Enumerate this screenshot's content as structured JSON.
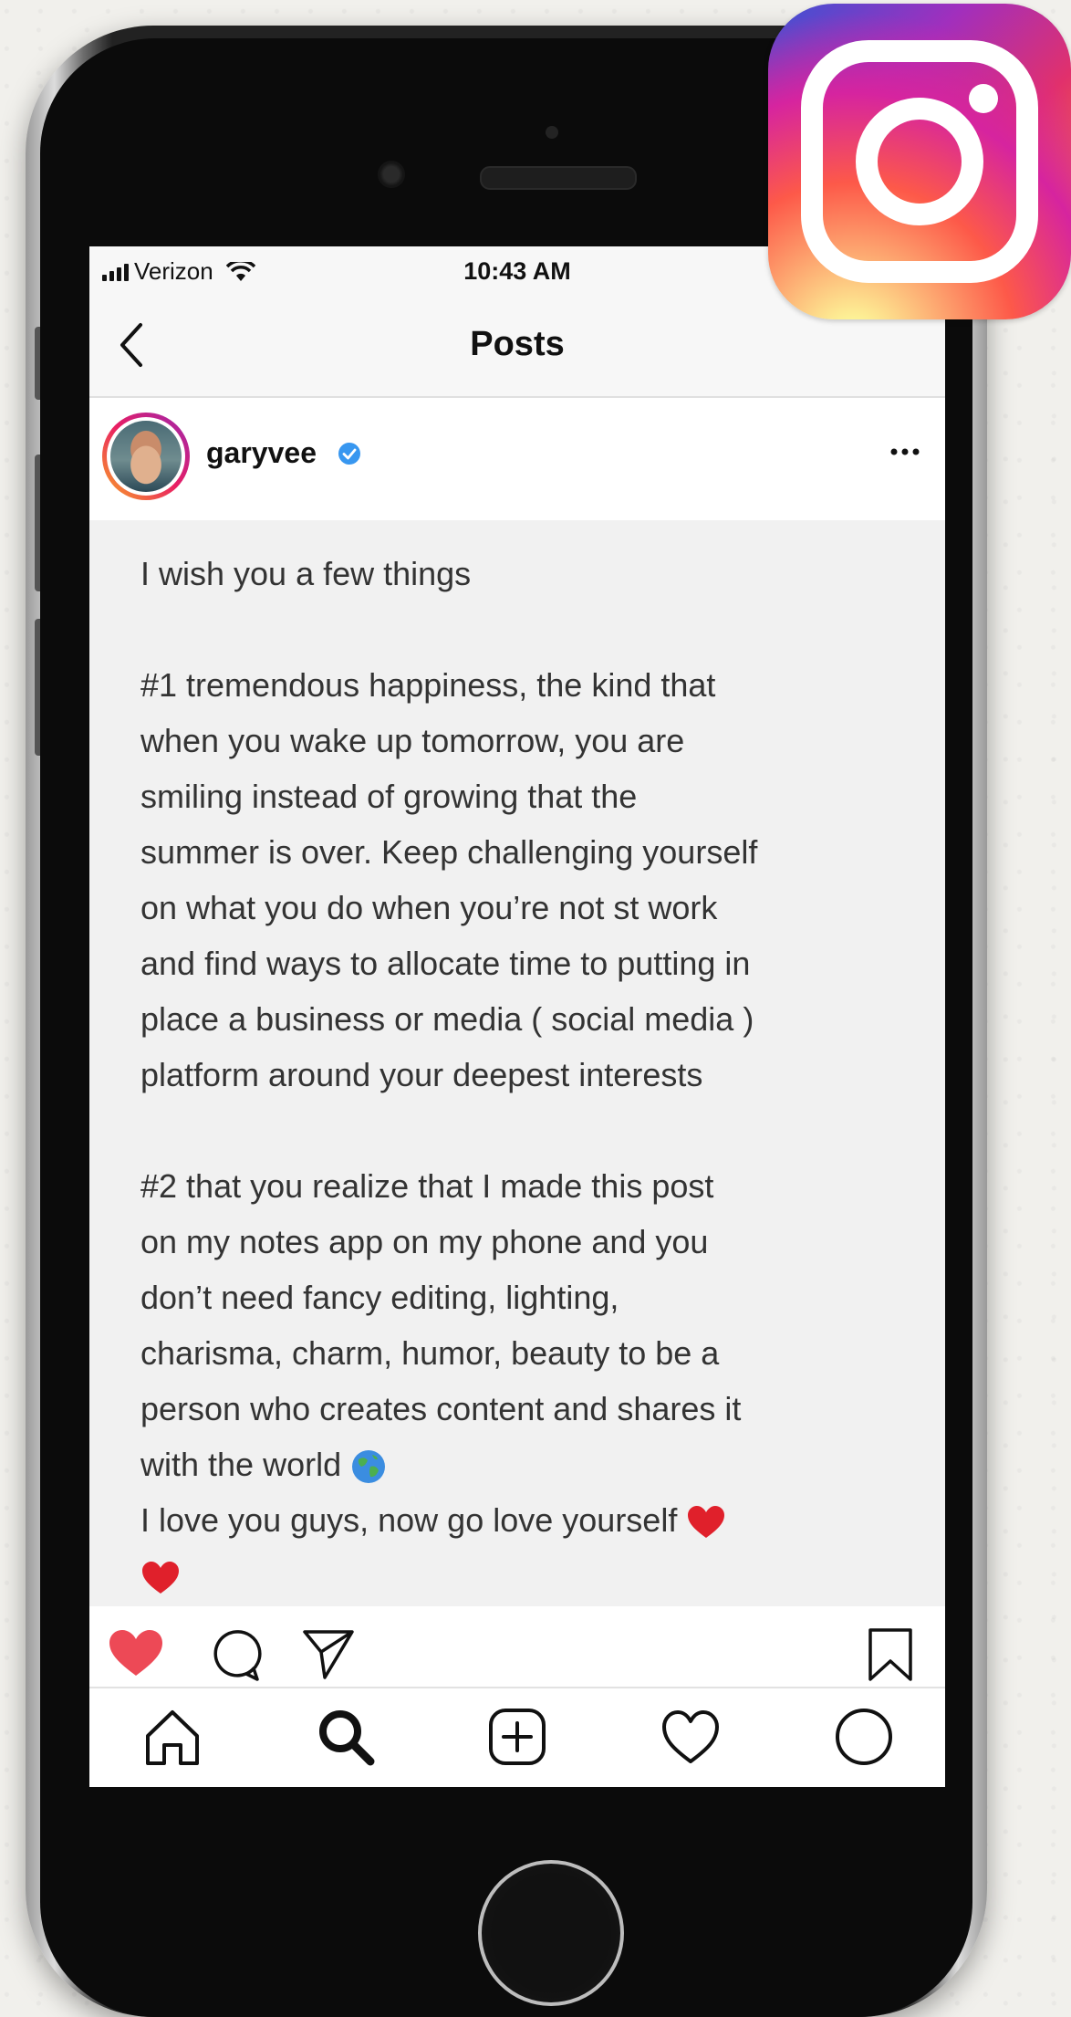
{
  "status_bar": {
    "carrier": "Verizon",
    "time": "10:43 AM"
  },
  "nav": {
    "title": "Posts"
  },
  "post": {
    "username": "garyvee",
    "verified": true,
    "caption_lines": [
      "I wish you a few things",
      "",
      "#1 tremendous happiness, the kind that",
      "when you wake up tomorrow, you are",
      "smiling instead of growing that the",
      "summer is over. Keep challenging yourself",
      "on what you do when you’re not st work",
      "and find ways to allocate time to putting in",
      "place a business or media ( social media )",
      "platform around your deepest interests",
      "",
      "#2 that you realize that I made this post",
      "on my notes app on my phone and you",
      "don’t need fancy editing, lighting,",
      "charisma, charm, humor, beauty to be a",
      "person who creates content and shares it",
      "with the world",
      "I love you guys, now go love yourself"
    ],
    "liked": true
  },
  "icons": {
    "back": "chevron-left-icon",
    "more": "more-horizontal-icon",
    "like": "heart-filled-icon",
    "comment": "comment-icon",
    "share": "send-icon",
    "save": "bookmark-icon",
    "home": "home-icon",
    "search": "search-icon",
    "add": "add-post-icon",
    "activity": "heart-outline-icon",
    "profile": "profile-icon",
    "brand": "instagram-logo"
  },
  "colors": {
    "like_red": "#ed4956",
    "verified_blue": "#3897f0",
    "text": "#333333"
  }
}
